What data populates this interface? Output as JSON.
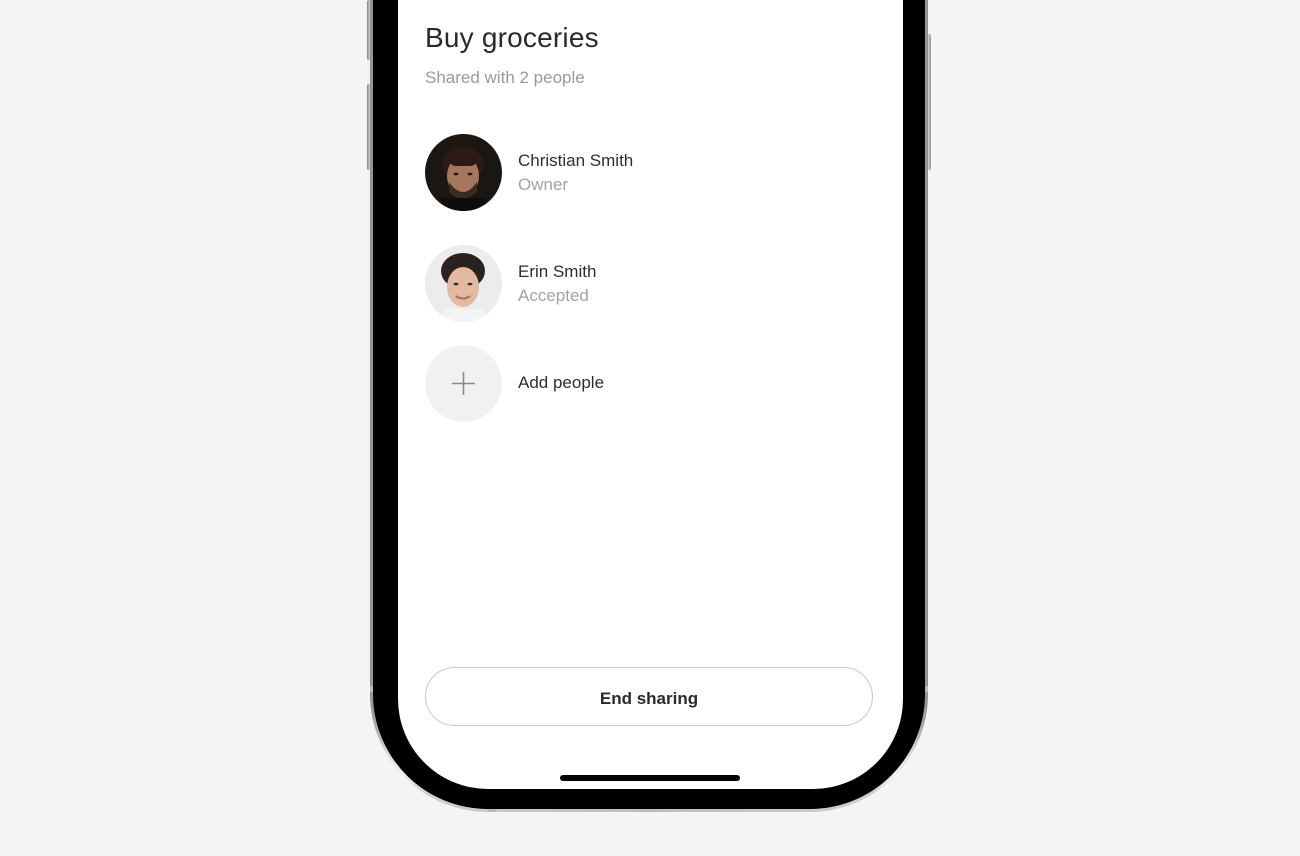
{
  "list": {
    "title": "Buy groceries",
    "subtitle": "Shared with 2 people"
  },
  "people": [
    {
      "name": "Christian Smith",
      "role": "Owner"
    },
    {
      "name": "Erin Smith",
      "role": "Accepted"
    }
  ],
  "add_people": {
    "label": "Add people",
    "icon": "plus-icon"
  },
  "actions": {
    "end_sharing_label": "End sharing"
  },
  "colors": {
    "background": "#f4f4f4",
    "screen": "#ffffff",
    "text_primary": "#2a2a2a",
    "text_secondary": "#9a9a9a",
    "add_circle": "#f1f1f3"
  }
}
